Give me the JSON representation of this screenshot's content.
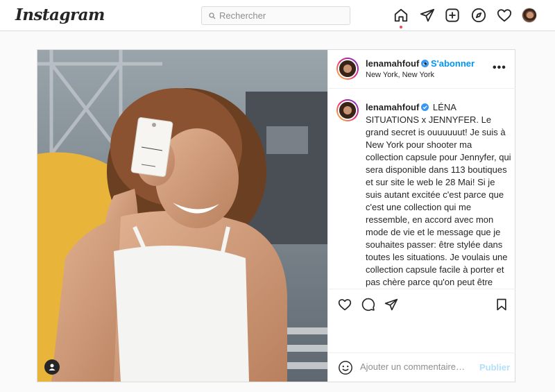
{
  "header": {
    "logo": "Instagram",
    "search_placeholder": "Rechercher",
    "icons": [
      "home-icon",
      "direct-send-icon",
      "new-post-icon",
      "explore-compass-icon",
      "activity-heart-icon",
      "profile-avatar"
    ]
  },
  "post": {
    "username": "lenamahfouf",
    "separator": "•",
    "follow_label": "S'abonner",
    "location": "New York, New York",
    "more_label": "•••",
    "caption": "LÉNA SITUATIONS x JENNYFER. Le grand secret is ouuuuuut! Je suis à New York pour shooter ma collection capsule pour Jennyfer, qui sera disponible dans 113 boutiques et sur site le web le 28 Mai! Si je suis autant excitée c'est parce que c'est une collection qui me ressemble, en accord avec mon mode de vie et le message que je souhaites passer: être stylée dans toutes les situations. Je voulais une collection capsule facile à porter et pas chère parce qu'on peut être fauchées et stylées 👅👅👅 J'ai vraiment fait chier tout le monde ( jusqu'à ce matin même mdrrr) pour vous proposer les choses les plus cool! Je ne voulais pas juste donner mon nom sur le travail des",
    "comment_placeholder": "Ajouter un commentaire…",
    "publish_label": "Publier"
  },
  "colors": {
    "link_blue": "#0095f6",
    "publish_disabled": "#b2dffc",
    "notification_dot": "#ed4956",
    "border": "#dbdbdb"
  }
}
